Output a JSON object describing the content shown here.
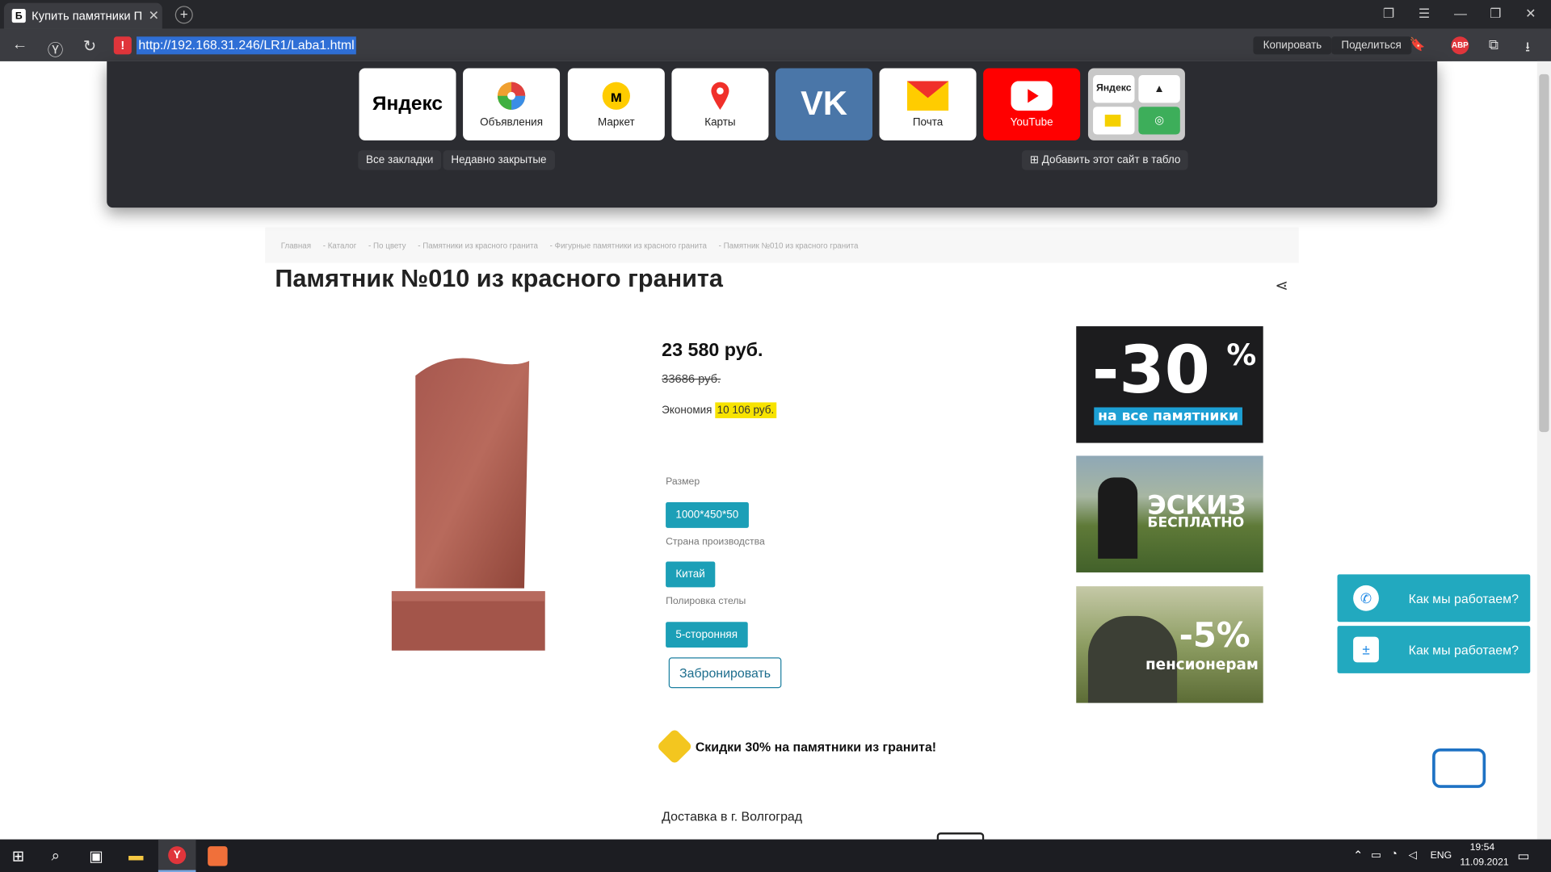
{
  "browser": {
    "tab_title": "Купить памятники Пам",
    "tab_favicon": "Б",
    "url": "http://192.168.31.246/LR1/Laba1.html",
    "copy_label": "Копировать",
    "share_label": "Поделиться",
    "abp_label": "ABP"
  },
  "speed_dial": {
    "tiles": [
      {
        "label": "Яндекс"
      },
      {
        "label": "Объявления"
      },
      {
        "label": "Маркет"
      },
      {
        "label": "Карты"
      },
      {
        "label": "VK"
      },
      {
        "label": "Почта"
      },
      {
        "label": "YouTube"
      },
      {
        "label": "Яндекс"
      }
    ],
    "all_bookmarks": "Все закладки",
    "recently_closed": "Недавно закрытые",
    "add_site": "Добавить этот сайт в табло"
  },
  "page": {
    "breadcrumb": [
      "Главная",
      "- Каталог",
      "- По цвету",
      "- Памятники из красного гранита",
      "- Фигурные памятники из красного гранита",
      "- Памятник №010 из красного гранита"
    ],
    "title": "Памятник №010 из красного гранита",
    "price": "23 580 руб.",
    "old_price": "33686 руб.",
    "economy_label": "Экономия",
    "economy_value": "10 106 руб.",
    "size_label": "Размер",
    "size_value": "1000*450*50",
    "country_label": "Страна производства",
    "country_value": "Китай",
    "polish_label": "Полировка стелы",
    "polish_value": "5-сторонняя",
    "reserve_button": "Забронировать",
    "promo_text": "Скидки 30% на памятники из гранита!",
    "delivery_text": "Доставка в г. Волгоград",
    "banners": {
      "b1_big": "-30",
      "b1_pct": "%",
      "b1_sub": "на все памятники",
      "b2_line1": "ЭСКИЗ",
      "b2_line2": "БЕСПЛАТНО",
      "b3_big": "-5%",
      "b3_sub": "пенсионерам"
    },
    "widgets": [
      "Как мы работаем?",
      "Как мы работаем?"
    ]
  },
  "taskbar": {
    "lang": "ENG",
    "time": "19:54",
    "date": "11.09.2021"
  },
  "colors": {
    "accent": "#1c9fb7",
    "promo_yellow": "#f3c61f",
    "youtube_red": "#ff0000",
    "vk_blue": "#4a76a8"
  }
}
